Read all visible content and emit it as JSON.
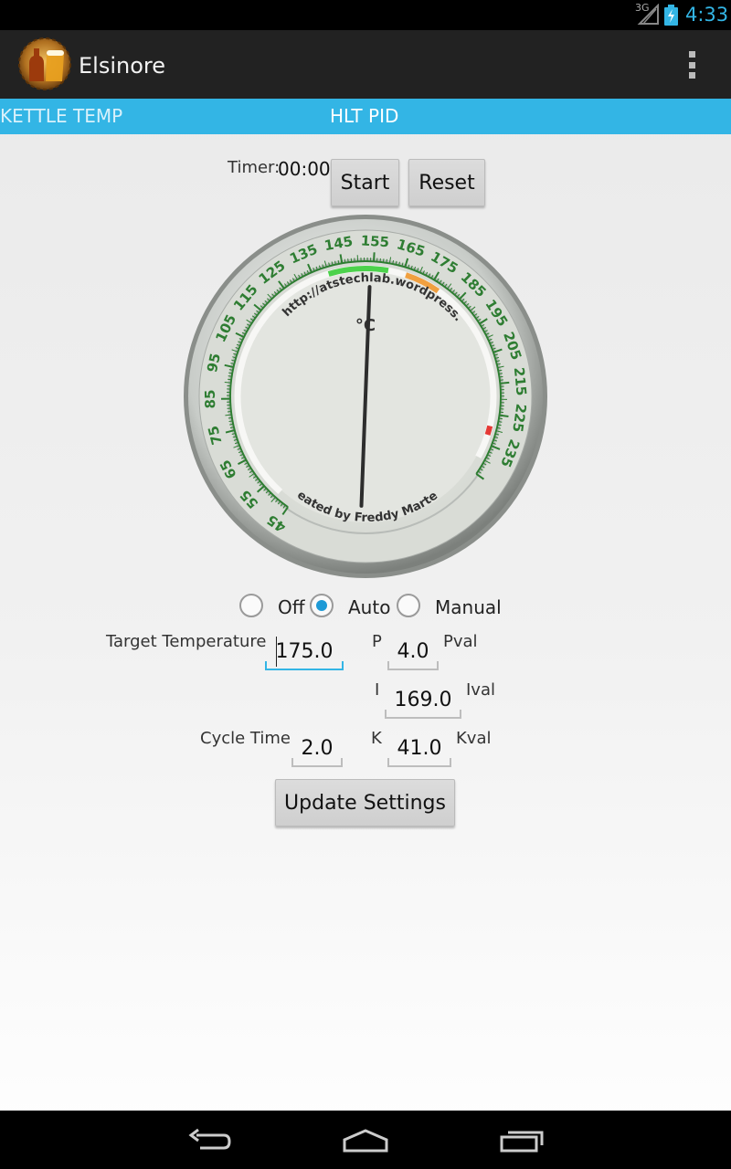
{
  "status_bar": {
    "network": "3G",
    "time": "4:33"
  },
  "action_bar": {
    "title": "Elsinore",
    "app_icon": "beer-bottle-glass-icon",
    "overflow_icon": "overflow-menu-icon"
  },
  "tabs": [
    {
      "label": "KETTLE TEMP",
      "selected": false
    },
    {
      "label": "HLT PID",
      "selected": true
    }
  ],
  "timer": {
    "label": "Timer:",
    "value": "00:00",
    "start_label": "Start",
    "reset_label": "Reset"
  },
  "gauge": {
    "unit": "°C",
    "top_text": "Visit http://atstechlab.wordpress.com",
    "bottom_text": "Created by Freddy Martens",
    "scale_min": 45,
    "scale_max": 245,
    "tick_labels": [
      45,
      55,
      65,
      75,
      85,
      95,
      105,
      115,
      125,
      135,
      145,
      155,
      165,
      175,
      185,
      195,
      205,
      215,
      225,
      235
    ],
    "needle_value": 154,
    "colors": {
      "scale": "#2e7d32",
      "green_band": "#4cd24c",
      "orange_band": "#f0a040",
      "red_mark": "#e53935",
      "needle": "#333333"
    }
  },
  "mode": {
    "options": [
      {
        "label": "Off",
        "checked": false
      },
      {
        "label": "Auto",
        "checked": true
      },
      {
        "label": "Manual",
        "checked": false
      }
    ]
  },
  "settings": {
    "target_temp_label": "Target Temperature",
    "target_temp_value": "175.0",
    "cycle_time_label": "Cycle Time",
    "cycle_time_value": "2.0",
    "p_label": "P",
    "p_value": "4.0",
    "pval_label": "Pval",
    "i_label": "I",
    "i_value": "169.0",
    "ival_label": "Ival",
    "k_label": "K",
    "k_value": "41.0",
    "kval_label": "Kval",
    "update_label": "Update Settings"
  },
  "nav_bar": {
    "back_icon": "back-icon",
    "home_icon": "home-icon",
    "recents_icon": "recents-icon"
  },
  "colors": {
    "accent": "#33b5e5",
    "action_bar": "#222222",
    "radio_checked": "#1e9ad6"
  }
}
